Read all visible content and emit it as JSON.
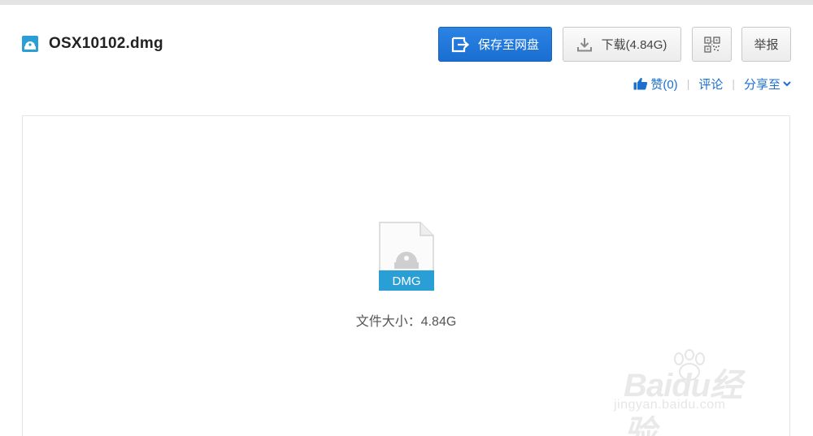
{
  "file": {
    "name": "OSX10102.dmg",
    "icon": "disk-image-icon"
  },
  "toolbar": {
    "save_label": "保存至网盘",
    "download_label": "下载(4.84G)",
    "qr_icon": "qr-code-icon",
    "report_label": "举报"
  },
  "actions": {
    "like_label": "赞(0)",
    "comment_label": "评论",
    "share_label": "分享至",
    "separator": "|"
  },
  "preview": {
    "file_type_label": "DMG",
    "size_text": "文件大小：4.84G"
  },
  "watermark": {
    "brand": "Baidu经验",
    "url": "jingyan.baidu.com"
  },
  "colors": {
    "accent": "#1a6fd1",
    "dmg_badge": "#2a9fd6"
  }
}
